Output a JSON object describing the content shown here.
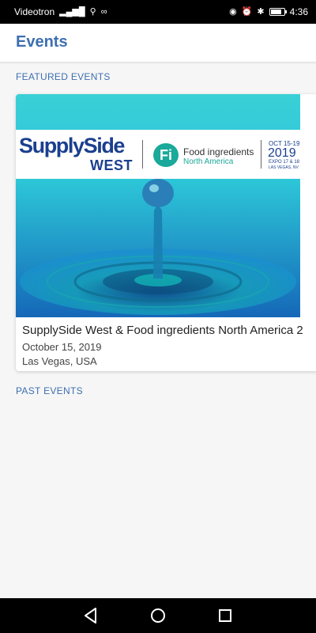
{
  "status_bar": {
    "carrier": "Videotron",
    "time": "4:36",
    "icons": [
      "signal-icon",
      "usb-icon",
      "voicemail-icon",
      "eye-icon",
      "alarm-icon",
      "bluetooth-icon",
      "battery-icon"
    ],
    "battery_level": 0.8
  },
  "app_bar": {
    "title": "Events"
  },
  "featured": {
    "section_label": "FEATURED EVENTS",
    "card": {
      "title": "SupplySide West & Food ingredients North America 2",
      "date": "October 15, 2019",
      "location": "Las Vegas, USA",
      "banner": {
        "brand_main": "SupplySide",
        "brand_sub": "WEST",
        "fi_badge": "Fi",
        "fi_name": "Food ingredients",
        "fi_region": "North America",
        "date_range": "OCT 15-19",
        "year": "2019",
        "expo": "EXPO 17 & 18",
        "city": "LAS VEGAS, NV"
      }
    }
  },
  "past": {
    "section_label": "PAST EVENTS"
  },
  "nav_bar": {
    "buttons": [
      "back-icon",
      "home-icon",
      "recents-icon"
    ]
  },
  "colors": {
    "accent": "#3e6fb0",
    "status_bar": "#000000",
    "background": "#f6f6f6"
  }
}
